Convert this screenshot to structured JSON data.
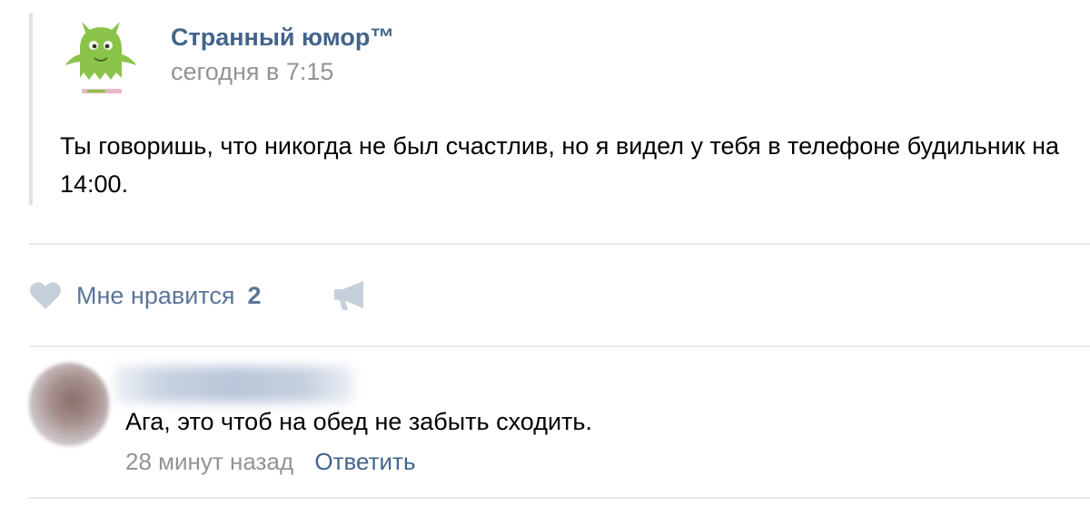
{
  "post": {
    "group_name": "Странный юмор™",
    "time": "сегодня в 7:15",
    "text": "Ты говоришь, что никогда не был счастлив, но я видел у тебя в телефоне будильник на 14:00.",
    "avatar_icon": "green-monster-icon"
  },
  "actions": {
    "like_label": "Мне нравится",
    "like_count": "2",
    "like_icon": "heart-icon",
    "share_icon": "megaphone-icon"
  },
  "comment": {
    "text": "Ага, это чтоб на обед не забыть сходить.",
    "time": "28 минут назад",
    "reply_label": "Ответить"
  },
  "colors": {
    "link": "#42648b",
    "muted": "#939393",
    "action": "#5b7597",
    "icon": "#c5d0db",
    "avatar_green": "#8bc34a"
  }
}
